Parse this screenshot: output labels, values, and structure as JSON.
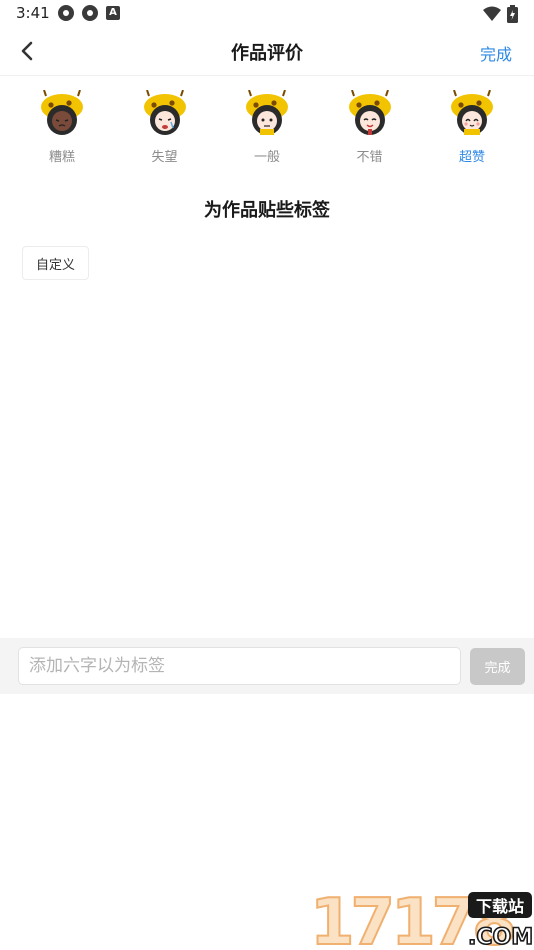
{
  "status_bar": {
    "time": "3:41",
    "left_icons": [
      "aperture-icon",
      "aperture-icon",
      "a-badge-icon"
    ],
    "right_icons": [
      "wifi-icon",
      "battery-icon"
    ],
    "a_badge": "A"
  },
  "nav": {
    "back_icon": "chevron-left-icon",
    "title": "作品评价",
    "done_label": "完成",
    "accent_color": "#2e8ae6"
  },
  "ratings": {
    "items": [
      {
        "label": "糟糕",
        "selected": false
      },
      {
        "label": "失望",
        "selected": false
      },
      {
        "label": "一般",
        "selected": false
      },
      {
        "label": "不错",
        "selected": false
      },
      {
        "label": "超赞",
        "selected": true
      }
    ]
  },
  "tags": {
    "heading": "为作品贴些标签",
    "custom_tag_label": "自定义"
  },
  "input_bar": {
    "placeholder": "添加六字以为标签",
    "value": "",
    "done_label": "完成"
  },
  "watermark": {
    "main": "17178",
    "badge": "下载站",
    "suffix": ".COM"
  }
}
